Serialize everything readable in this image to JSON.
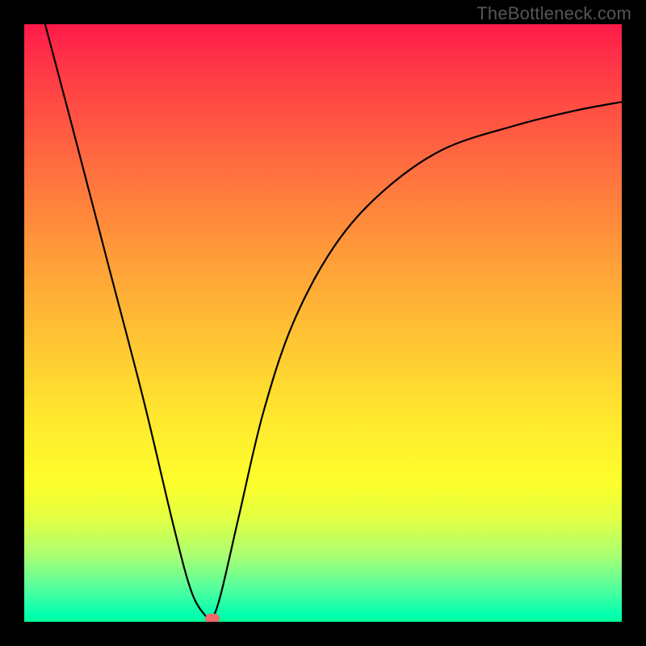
{
  "watermark": "TheBottleneck.com",
  "chart_data": {
    "type": "line",
    "title": "",
    "xlabel": "",
    "ylabel": "",
    "xlim": [
      0,
      1
    ],
    "ylim": [
      0,
      1
    ],
    "series": [
      {
        "name": "curve",
        "x": [
          0.035,
          0.08,
          0.14,
          0.2,
          0.25,
          0.28,
          0.305,
          0.315,
          0.33,
          0.36,
          0.4,
          0.45,
          0.52,
          0.6,
          0.7,
          0.82,
          0.92,
          1.0
        ],
        "values": [
          1.0,
          0.83,
          0.6,
          0.37,
          0.16,
          0.05,
          0.008,
          0.006,
          0.05,
          0.18,
          0.35,
          0.5,
          0.63,
          0.72,
          0.79,
          0.83,
          0.855,
          0.87
        ]
      }
    ],
    "annotations": [
      {
        "name": "min-point",
        "x": 0.315,
        "y": 0.006
      }
    ],
    "background": {
      "type": "vertical-gradient",
      "stops": [
        {
          "pos": 0.0,
          "color": "#ff1a4a"
        },
        {
          "pos": 0.5,
          "color": "#ffc234"
        },
        {
          "pos": 0.8,
          "color": "#fdff2c"
        },
        {
          "pos": 0.95,
          "color": "#5aff9c"
        },
        {
          "pos": 1.0,
          "color": "#00ff94"
        }
      ]
    }
  }
}
